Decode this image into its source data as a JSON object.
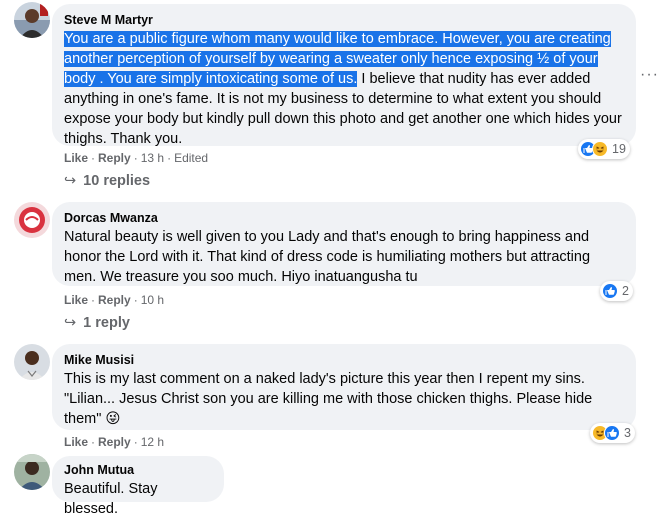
{
  "comments": [
    {
      "author": "Steve M Martyr",
      "text_highlighted": "You are a public figure whom many would like to embrace. However, you are creating another perception of yourself by wearing a sweater only hence exposing ½ of your body . You are simply intoxicating some of us.",
      "text_rest": " I believe that nudity has ever added anything in one's fame. It is not my business to determine to what extent you should expose your body but kindly pull down this photo and get another one which hides your thighs. Thank you.",
      "like": "Like",
      "reply": "Reply",
      "time": "13 h",
      "edited": "Edited",
      "reaction_count": "19",
      "replies": "10 replies"
    },
    {
      "author": "Dorcas Mwanza",
      "text": "Natural beauty is well given to you Lady and that's enough to bring happiness and honor the Lord with it. That kind of dress code is humiliating mothers but attracting men. We treasure you soo much. Hiyo inatuangusha tu",
      "like": "Like",
      "reply": "Reply",
      "time": "10 h",
      "reaction_count": "2",
      "replies": "1 reply"
    },
    {
      "author": "Mike Musisi",
      "text": "This is my last comment on a naked lady's picture this year then I repent my sins. \"Lilian... Jesus Christ son you are killing me with those chicken thighs. Please hide them\" 😜",
      "like": "Like",
      "reply": "Reply",
      "time": "12 h",
      "reaction_count": "3"
    },
    {
      "author": "John Mutua",
      "text": "Beautiful. Stay blessed."
    }
  ],
  "icons": {
    "more": "more-options-icon",
    "reply_arrow": "reply-arrow-icon",
    "like_reaction": "like-reaction-icon",
    "haha_reaction": "haha-reaction-icon"
  },
  "colors": {
    "bubble": "#f0f2f5",
    "highlight": "#1a73e8",
    "meta_text": "#65676b",
    "like_blue": "#1877f2",
    "haha_yellow": "#f7b928"
  },
  "more_glyph": "···",
  "reply_arrow_glyph": "↪"
}
